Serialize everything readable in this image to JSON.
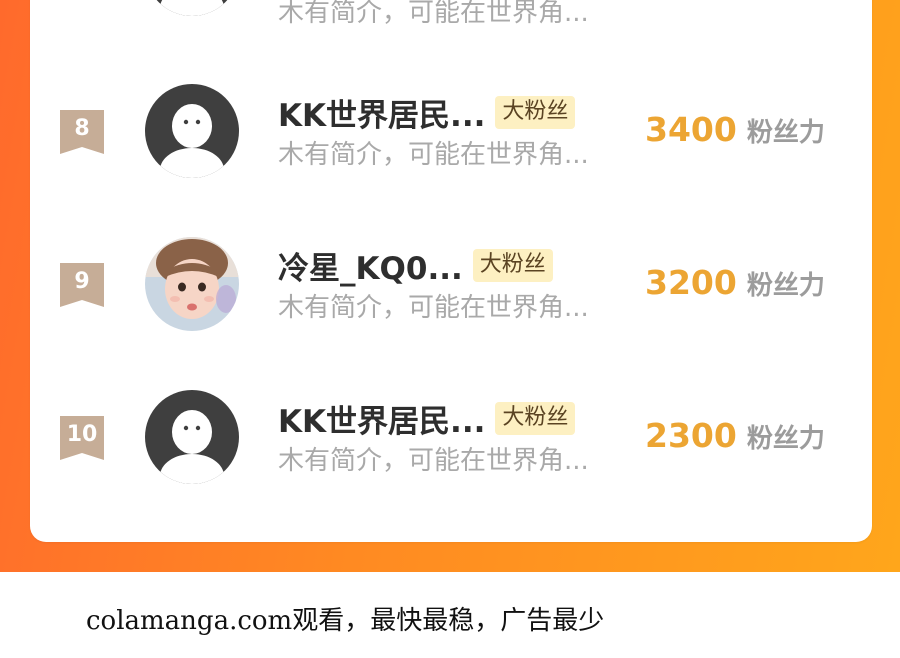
{
  "fan_badge_label": "大粉丝",
  "score_unit": "粉丝力",
  "top_partial_row": {
    "intro": "木有简介，可能在世界角..."
  },
  "rows": [
    {
      "rank": "8",
      "name": "KK世界居民...",
      "badge": "大粉丝",
      "intro": "木有简介，可能在世界角...",
      "score": "3400",
      "unit": "粉丝力",
      "avatar": "default-avatar"
    },
    {
      "rank": "9",
      "name": "冷星_KQ0...",
      "badge": "大粉丝",
      "intro": "木有简介，可能在世界角...",
      "score": "3200",
      "unit": "粉丝力",
      "avatar": "child-photo-avatar"
    },
    {
      "rank": "10",
      "name": "KK世界居民...",
      "badge": "大粉丝",
      "intro": "木有简介，可能在世界角...",
      "score": "2300",
      "unit": "粉丝力",
      "avatar": "default-avatar"
    }
  ],
  "colors": {
    "background_gradient": [
      "#ff6a2c",
      "#ffa61b"
    ],
    "rank_badge": "#c6ad97",
    "score": "#eca533",
    "fan_badge_bg": "#fdf0c2"
  },
  "watermark": "colamanga.com观看，最快最稳，广告最少"
}
